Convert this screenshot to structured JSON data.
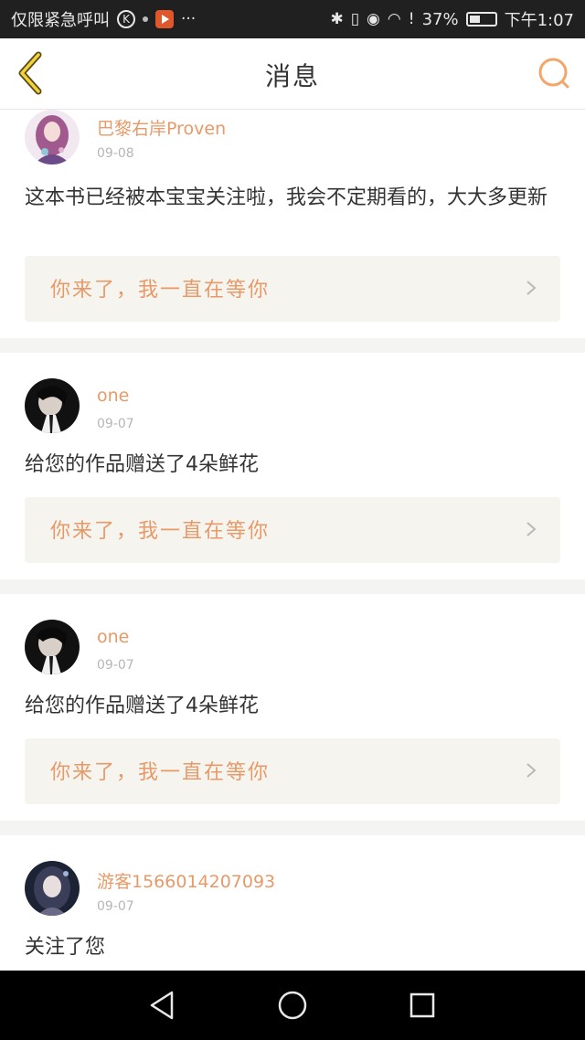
{
  "status_bar": {
    "carrier": "仅限紧急呼叫",
    "k_badge": "K",
    "more": "···",
    "battery": "37%",
    "time": "下午1:07",
    "icons": [
      "bluetooth-icon",
      "vibrate-icon",
      "eye-icon",
      "wifi-icon",
      "alert-icon",
      "battery-icon"
    ]
  },
  "header": {
    "title": "消息",
    "back_icon": "chevron-left-icon",
    "search_icon": "search-icon",
    "accent_color": "#e79a68"
  },
  "messages": [
    {
      "name": "巴黎右岸Proven",
      "date": "09-08",
      "text": "这本书已经被本宝宝关注啦，我会不定期看的，大大多更新",
      "reply": "你来了，我一直在等你"
    },
    {
      "name": "one",
      "date": "09-07",
      "text": "给您的作品赠送了4朵鲜花",
      "reply": "你来了，我一直在等你"
    },
    {
      "name": "one",
      "date": "09-07",
      "text": "给您的作品赠送了4朵鲜花",
      "reply": "你来了，我一直在等你"
    },
    {
      "name": "游客1566014207093",
      "date": "09-07",
      "text": "关注了您"
    }
  ],
  "nav_bar": {
    "back_icon": "triangle-back-icon",
    "home_icon": "circle-home-icon",
    "recents_icon": "square-recents-icon"
  }
}
